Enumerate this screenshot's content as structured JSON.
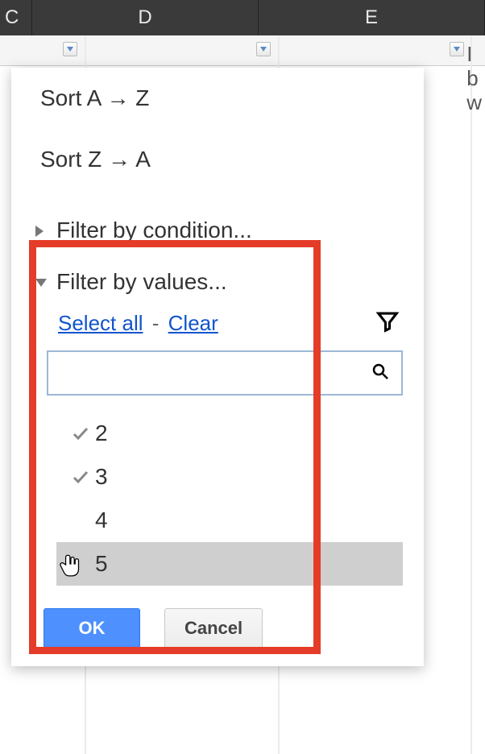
{
  "columns": {
    "c": "C",
    "d": "D",
    "e": "E"
  },
  "right_cell_text": "I\nb\nw",
  "left_fragment": "",
  "panel": {
    "sort_az": "Sort A → Z",
    "sort_za": "Sort Z → A",
    "filter_condition": "Filter by condition...",
    "filter_values": "Filter by values...",
    "select_all": "Select all",
    "clear": "Clear",
    "separator": "-",
    "search_placeholder": "",
    "values": [
      {
        "label": "2",
        "checked": true,
        "hovered": false
      },
      {
        "label": "3",
        "checked": true,
        "hovered": false
      },
      {
        "label": "4",
        "checked": false,
        "hovered": false
      },
      {
        "label": "5",
        "checked": false,
        "hovered": true
      }
    ],
    "ok": "OK",
    "cancel": "Cancel"
  }
}
